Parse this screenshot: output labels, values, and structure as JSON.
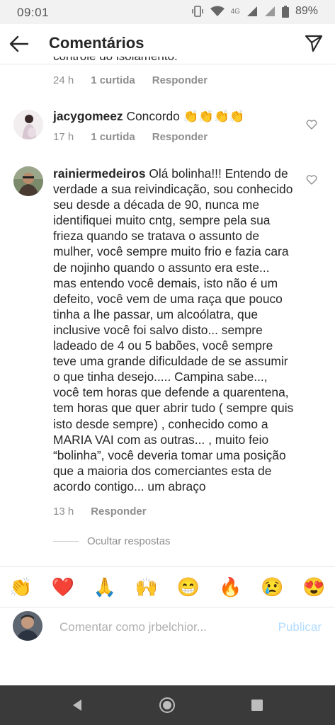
{
  "status_bar": {
    "time": "09:01",
    "network": "4G",
    "battery": "89%"
  },
  "header": {
    "title": "Comentários"
  },
  "comments": [
    {
      "clipped_text": "controle do isolamento.",
      "time": "24 h",
      "likes": "1 curtida",
      "reply": "Responder"
    },
    {
      "username": "jacygomeez",
      "text": "Concordo 👏👏👏👏",
      "time": "17 h",
      "likes": "1 curtida",
      "reply": "Responder"
    },
    {
      "username": "rainiermedeiros",
      "text": "Olá bolinha!!! Entendo de verdade a sua reivindicação, sou conhecido seu desde a década de 90, nunca me identifiquei muito cntg, sempre pela sua frieza quando se tratava o assunto de mulher, você sempre muito frio e fazia cara de nojinho quando o assunto era este... mas entendo você demais, isto não é um defeito, você vem de uma raça que pouco tinha a lhe passar, um alcoólatra, que inclusive você foi salvo disto... sempre ladeado de 4 ou 5 babões, você sempre teve uma grande dificuldade de se assumir o que tinha desejo..... Campina sabe..., você tem horas que defende a quarentena, tem horas que quer abrir tudo ( sempre quis isto desde sempre) , conhecido como a MARIA VAI com as outras... , muito feio “bolinha”, você deveria tomar uma posição que a maioria dos comerciantes esta de acordo contigo... um abraço",
      "time": "13 h",
      "reply": "Responder"
    }
  ],
  "hide_replies": "Ocultar respostas",
  "emoji_bar": [
    "👏",
    "❤️",
    "🙏",
    "🙌",
    "😁",
    "🔥",
    "😢",
    "😍"
  ],
  "compose": {
    "placeholder": "Comentar como jrbelchior...",
    "publish": "Publicar"
  },
  "colors": {
    "accent": "#b3dbff",
    "text": "#262626",
    "muted": "#8e8e8e",
    "navbar": "#3a3a3a"
  }
}
